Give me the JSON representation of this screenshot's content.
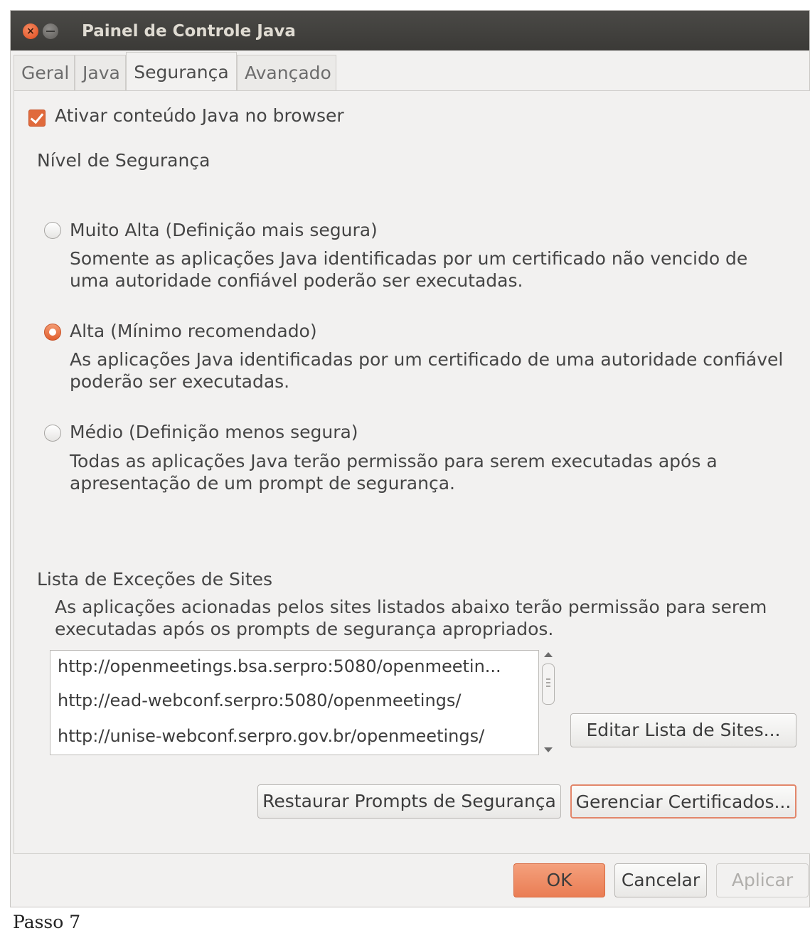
{
  "window": {
    "title": "Painel de Controle Java",
    "close_glyph": "×"
  },
  "tabs": [
    {
      "label": "Geral",
      "active": false
    },
    {
      "label": "Java",
      "active": false
    },
    {
      "label": "Segurança",
      "active": true
    },
    {
      "label": "Avançado",
      "active": false
    }
  ],
  "security": {
    "enable_java_label": "Ativar conteúdo Java no browser",
    "enable_java_checked": true,
    "level_heading": "Nível de Segurança",
    "levels": [
      {
        "label": "Muito Alta (Definição mais segura)",
        "description": "Somente as aplicações Java identificadas por um certificado não vencido de uma autoridade confiável poderão ser executadas.",
        "selected": false
      },
      {
        "label": "Alta (Mínimo recomendado)",
        "description": "As aplicações Java identificadas por um certificado de uma autoridade confiável poderão ser executadas.",
        "selected": true
      },
      {
        "label": "Médio (Definição menos segura)",
        "description": "Todas as aplicações Java terão permissão para serem executadas após a apresentação de um prompt de segurança.",
        "selected": false
      }
    ],
    "exceptions_heading": "Lista de Exceções de Sites",
    "exceptions_description": "As aplicações acionadas pelos sites listados abaixo terão permissão para serem executadas após os prompts de segurança apropriados.",
    "sites": [
      "http://openmeetings.bsa.serpro:5080/openmeetin...",
      "http://ead-webconf.serpro:5080/openmeetings/",
      "http://unise-webconf.serpro.gov.br/openmeetings/"
    ],
    "edit_sites_button": "Editar Lista de Sites...",
    "restore_prompts_button": "Restaurar Prompts de Segurança",
    "manage_certificates_button": "Gerenciar Certificados..."
  },
  "footer": {
    "ok": "OK",
    "cancel": "Cancelar",
    "apply": "Aplicar"
  },
  "caption": "Passo 7",
  "colors": {
    "accent": "#e2602f",
    "titlebar": "#3b3a37",
    "background": "#f2f1f0"
  }
}
